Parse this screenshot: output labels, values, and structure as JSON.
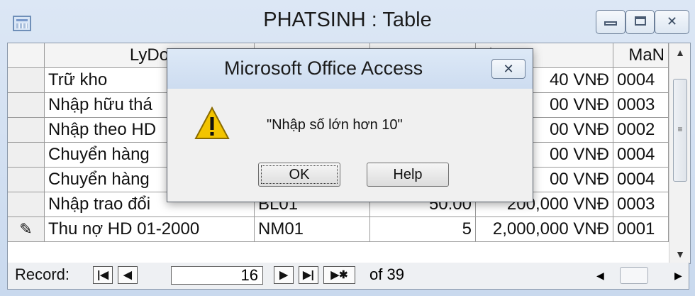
{
  "window": {
    "title": "PHATSINH : Table"
  },
  "table": {
    "headers": [
      "",
      "LyDo",
      "",
      "",
      "gia",
      "MaN"
    ],
    "rows": [
      {
        "sel": "",
        "lydo": "Trữ kho",
        "c2": "",
        "c3": "",
        "gia": "40 VNĐ",
        "ma": "0004"
      },
      {
        "sel": "",
        "lydo": "Nhập hữu thá",
        "c2": "",
        "c3": "",
        "gia": "00 VNĐ",
        "ma": "0003"
      },
      {
        "sel": "",
        "lydo": "Nhập theo HD",
        "c2": "",
        "c3": "",
        "gia": "00 VNĐ",
        "ma": "0002"
      },
      {
        "sel": "",
        "lydo": "Chuyển hàng",
        "c2": "",
        "c3": "",
        "gia": "00 VNĐ",
        "ma": "0004"
      },
      {
        "sel": "",
        "lydo": "Chuyển hàng",
        "c2": "",
        "c3": "",
        "gia": "00 VNĐ",
        "ma": "0004"
      },
      {
        "sel": "",
        "lydo": "Nhập trao đổi",
        "c2": "BL01",
        "c3": "50.00",
        "gia": "200,000 VNĐ",
        "ma": "0003"
      },
      {
        "sel": "✎",
        "lydo": "Thu nợ HD 01-2000",
        "c2": "NM01",
        "c3": "5",
        "gia": "2,000,000 VNĐ",
        "ma": "0001"
      }
    ]
  },
  "navigator": {
    "label": "Record:",
    "current": "16",
    "total_text": "of 39",
    "first_icon": "first-record-icon",
    "prev_icon": "previous-record-icon",
    "next_icon": "next-record-icon",
    "last_icon": "last-record-icon",
    "new_icon": "new-record-icon"
  },
  "dialog": {
    "title": "Microsoft Office Access",
    "message": "\"Nhập số lớn hơn 10\"",
    "ok_label": "OK",
    "help_label": "Help",
    "icon": "warning-icon"
  }
}
